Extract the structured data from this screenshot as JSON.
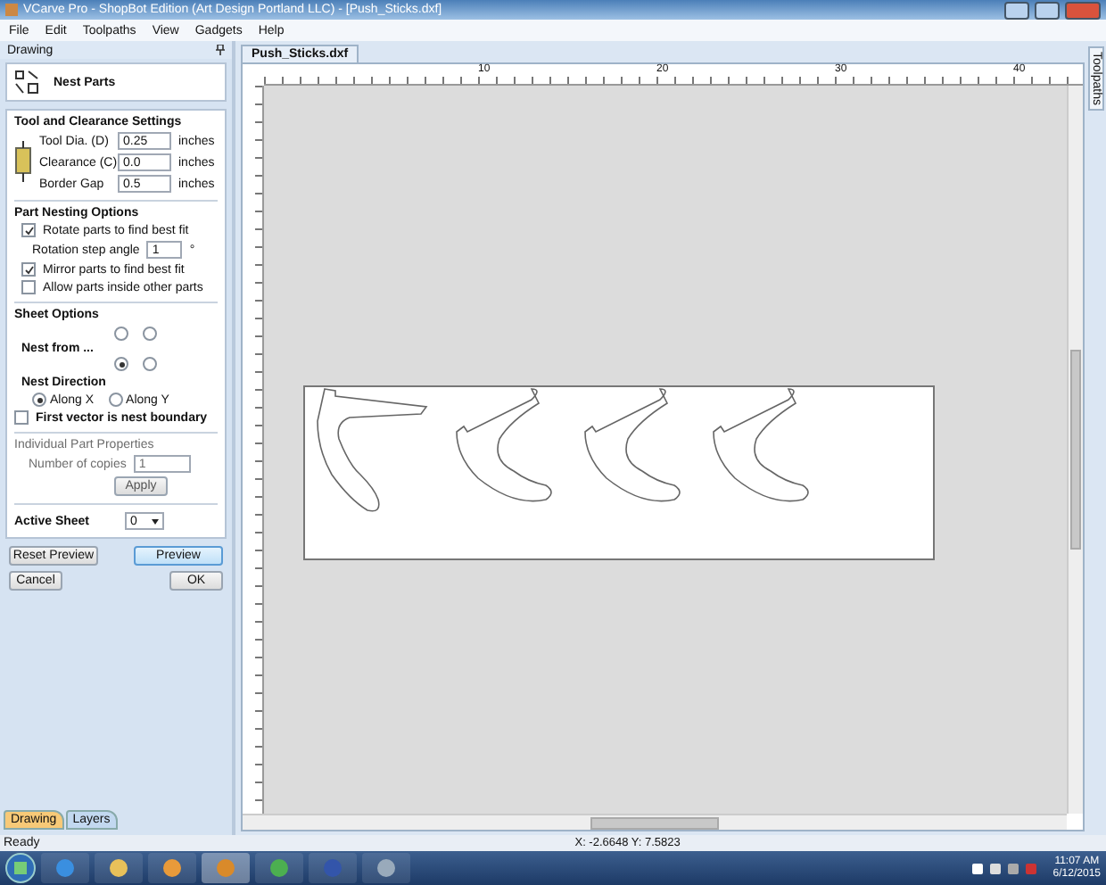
{
  "window": {
    "title": "VCarve Pro - ShopBot Edition (Art Design Portland LLC) - [Push_Sticks.dxf]"
  },
  "menu": [
    "File",
    "Edit",
    "Toolpaths",
    "View",
    "Gadgets",
    "Help"
  ],
  "left_panel": {
    "title": "Drawing",
    "tool_title": "Nest Parts",
    "tool_settings": {
      "heading": "Tool and Clearance Settings",
      "fields": [
        {
          "label": "Tool Dia. (D)",
          "value": "0.25",
          "unit": "inches"
        },
        {
          "label": "Clearance (C)",
          "value": "0.0",
          "unit": "inches"
        },
        {
          "label": "Border Gap",
          "value": "0.5",
          "unit": "inches"
        }
      ]
    },
    "nesting_options": {
      "heading": "Part Nesting Options",
      "items": [
        {
          "kind": "checkbox",
          "label": "Rotate parts to find best fit",
          "checked": true
        },
        {
          "kind": "field",
          "label": "Rotation step angle",
          "value": "1",
          "unit": "°"
        },
        {
          "kind": "checkbox",
          "label": "Mirror parts to find best fit",
          "checked": true
        },
        {
          "kind": "checkbox",
          "label": "Allow parts inside other parts",
          "checked": false
        }
      ]
    },
    "sheet_options": {
      "heading": "Sheet Options",
      "nest_from_label": "Nest from ...",
      "corners": [
        {
          "selected": false
        },
        {
          "selected": false
        },
        {
          "selected": true
        },
        {
          "selected": false
        }
      ],
      "direction_label": "Nest Direction",
      "directions": [
        {
          "label": "Along X",
          "selected": true
        },
        {
          "label": "Along Y",
          "selected": false
        }
      ],
      "first_vector": {
        "label": "First vector is nest boundary",
        "checked": false
      }
    },
    "part_properties": {
      "heading": "Individual Part Properties",
      "disabled": true,
      "copies_label": "Number of copies",
      "copies_value": "1",
      "apply": "Apply"
    },
    "active_sheet": {
      "label": "Active Sheet",
      "value": "0"
    },
    "buttons": [
      {
        "label": "Reset Preview",
        "primary": false
      },
      {
        "label": "Preview",
        "primary": true
      },
      {
        "label": "Cancel",
        "primary": false
      },
      {
        "label": "OK",
        "primary": false
      }
    ],
    "tabs": [
      {
        "label": "Drawing",
        "selected": true
      },
      {
        "label": "Layers",
        "selected": false
      }
    ]
  },
  "document": {
    "tab": "Push_Sticks.dxf",
    "ruler_labels": [
      "10",
      "20",
      "30",
      "40"
    ]
  },
  "right_tab": "Toolpaths",
  "status_bar": {
    "text": "Ready",
    "coordinates": "X: -2.6648 Y: 7.5823"
  },
  "taskbar": {
    "time": "11:07 AM",
    "date": "6/12/2015"
  }
}
